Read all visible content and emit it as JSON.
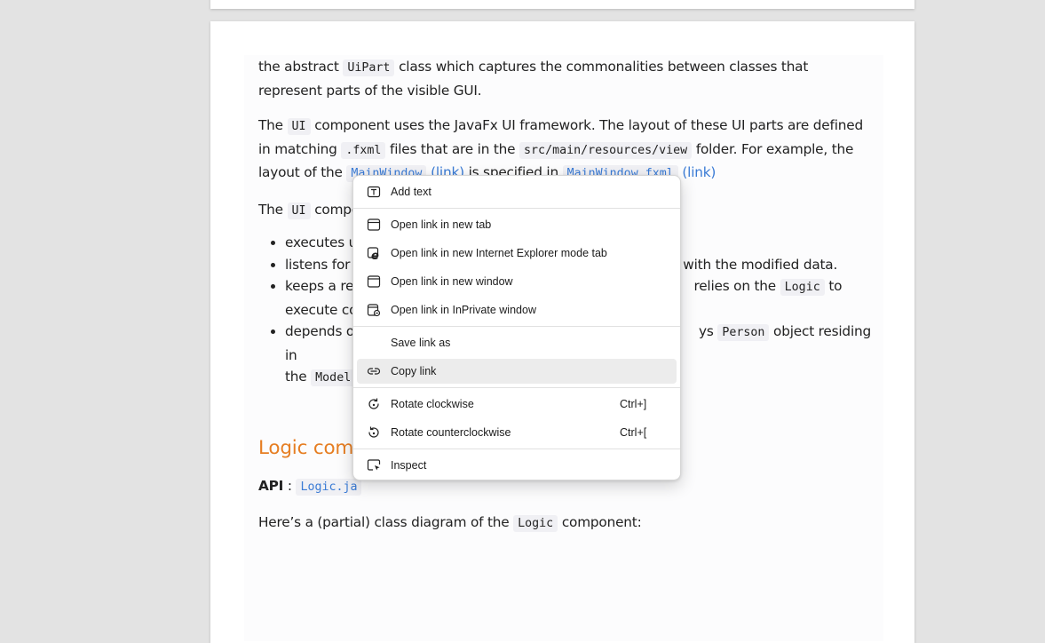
{
  "document": {
    "p1": {
      "t1": "the abstract ",
      "c1": "UiPart",
      "t2": " class which captures the commonalities between classes that represent parts of the visible GUI."
    },
    "p2": {
      "t1": "The ",
      "c1": "UI",
      "t2": " component uses the JavaFx UI framework. The layout of these UI parts are defined in matching ",
      "c2": ".fxml",
      "t3": " files that are in the ",
      "c3": "src/main/resources/view",
      "t4": " folder. For example, the layout of the ",
      "link1_code": "MainWindow",
      "link1_text": "(link)",
      "t5": " is specified in ",
      "link2_code": "MainWindow.fxml",
      "link2_text": "(link)"
    },
    "p3": {
      "t1": "The ",
      "c1": "UI",
      "t2": " compo"
    },
    "bullets": {
      "b1": "executes us",
      "b2_a": "listens for c",
      "b2_b": "d with the modified data.",
      "b3_a": "keeps a ref",
      "b3_b": "relies on the ",
      "b3_code": "Logic",
      "b3_c": " to",
      "b3_d": "execute co",
      "b4_a": "depends o",
      "b4_b": "ys ",
      "b4_code": "Person",
      "b4_c": " object residing in",
      "b4_d": "the ",
      "b4_code2": "Model"
    },
    "heading": "Logic comp",
    "api": {
      "label": "API",
      "sep": " : ",
      "link_code": "Logic.ja"
    },
    "p4": {
      "t1": "Here’s a (partial) class diagram of the ",
      "c1": "Logic",
      "t2": " component:"
    }
  },
  "context_menu": {
    "items": [
      {
        "icon": "add-text-icon",
        "label": "Add text",
        "shortcut": ""
      },
      {
        "icon": "new-tab-icon",
        "label": "Open link in new tab",
        "shortcut": ""
      },
      {
        "icon": "ie-mode-icon",
        "label": "Open link in new Internet Explorer mode tab",
        "shortcut": ""
      },
      {
        "icon": "new-window-icon",
        "label": "Open link in new window",
        "shortcut": ""
      },
      {
        "icon": "inprivate-window-icon",
        "label": "Open link in InPrivate window",
        "shortcut": ""
      },
      {
        "icon": "",
        "label": "Save link as",
        "shortcut": ""
      },
      {
        "icon": "link-icon",
        "label": "Copy link",
        "shortcut": ""
      },
      {
        "icon": "rotate-clockwise-icon",
        "label": "Rotate clockwise",
        "shortcut": "Ctrl+]"
      },
      {
        "icon": "rotate-counterclockwise-icon",
        "label": "Rotate counterclockwise",
        "shortcut": "Ctrl+["
      },
      {
        "icon": "inspect-icon",
        "label": "Inspect",
        "shortcut": ""
      }
    ],
    "highlighted": "Copy link"
  },
  "colors": {
    "heading": "#e67e22",
    "link": "#3a7bd5",
    "viewer_background": "#e3e3e3",
    "menu_hover": "#ececec"
  }
}
